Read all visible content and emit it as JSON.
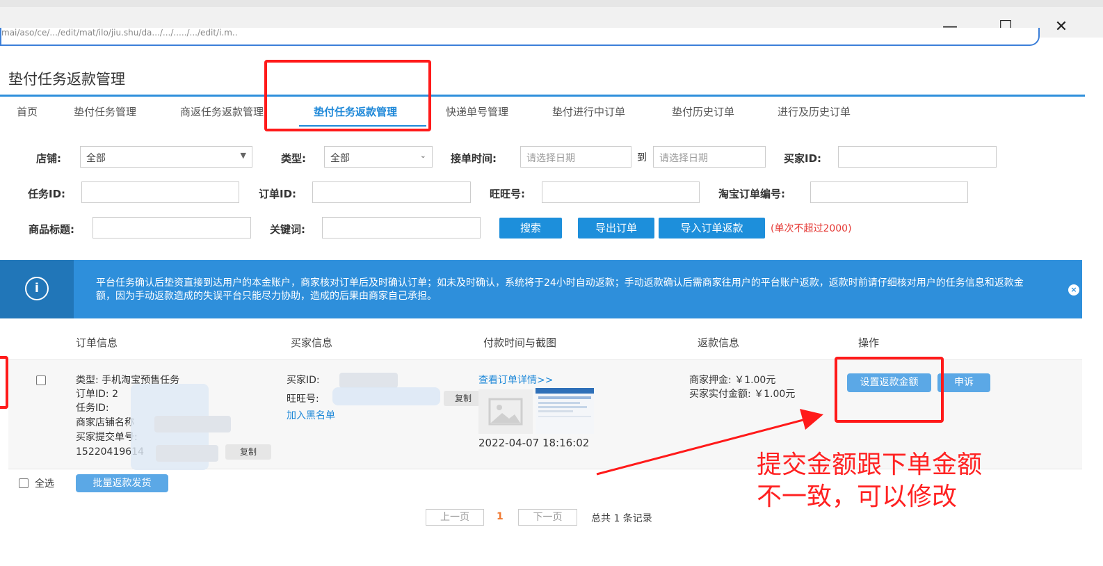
{
  "window": {
    "url": "mai/aso/ce/.../edit/mat/ilo/jiu.shu/da.../.../...../.../edit/i.m..",
    "minimize": "—",
    "maximize": "☐",
    "close": "✕"
  },
  "page": {
    "title": "垫付任务返款管理"
  },
  "tabs": [
    {
      "label": "首页"
    },
    {
      "label": "垫付任务管理"
    },
    {
      "label": "商返任务返款管理"
    },
    {
      "label": "垫付任务返款管理",
      "active": true
    },
    {
      "label": "快递单号管理"
    },
    {
      "label": "垫付进行中订单"
    },
    {
      "label": "垫付历史订单"
    },
    {
      "label": "进行及历史订单"
    }
  ],
  "filters": {
    "shop_label": "店铺:",
    "shop_value": "全部",
    "type_label": "类型:",
    "type_value": "全部",
    "time_label": "接单时间:",
    "date_placeholder_start": "请选择日期",
    "to_label": "到",
    "date_placeholder_end": "请选择日期",
    "buyer_id_label": "买家ID:",
    "task_id_label": "任务ID:",
    "order_id_label": "订单ID:",
    "wangwang_label": "旺旺号:",
    "taobao_order_label": "淘宝订单编号:",
    "product_title_label": "商品标题:",
    "keyword_label": "关键词:",
    "search_button": "搜索",
    "export_button": "导出订单",
    "import_button": "导入订单返款",
    "limit_note": "(单次不超过2000)"
  },
  "banner": {
    "icon": "i",
    "text": "平台任务确认后垫资直接到达用户的本金账户，商家核对订单后及时确认订单；如未及时确认，系统将于24小时自动返款；手动返款确认后需商家往用户的平台账户返款，返款时前请仔细核对用户的任务信息和返款金额，因为手动返款造成的失误平台只能尽力协助，造成的后果由商家自己承担。",
    "close": "×"
  },
  "table": {
    "headers": [
      "订单信息",
      "买家信息",
      "付款时间与截图",
      "返款信息",
      "操作"
    ],
    "row": {
      "type": "类型: 手机淘宝预售任务",
      "order_id": "订单ID: 2",
      "task_id": "任务ID:",
      "shop_name": "商家店铺名称",
      "buyer_submit_label": "买家提交单号:",
      "buyer_submit_no": "15220419614",
      "copy_label": "复制",
      "buyer_id": "买家ID:",
      "wangwang": "旺旺号:",
      "blacklist": "加入黑名单",
      "view_details": "查看订单详情>>",
      "pay_time": "2022-04-07 18:16:02",
      "deposit": "商家押金: ￥1.00元",
      "actual_paid": "买家实付金额: ￥1.00元",
      "set_refund_button": "设置返款金额",
      "appeal_button": "申诉"
    }
  },
  "footer": {
    "select_all": "全选",
    "batch_button": "批量返款发货",
    "prev": "上一页",
    "current_page": "1",
    "next": "下一页",
    "total": "总共 1 条记录"
  },
  "annotation": {
    "text_line1": "提交金额跟下单金额",
    "text_line2": "不一致，可以修改"
  },
  "colors": {
    "primary": "#1d8fdb",
    "banner": "#2e8fdb",
    "annotation": "#ff1a1a"
  }
}
